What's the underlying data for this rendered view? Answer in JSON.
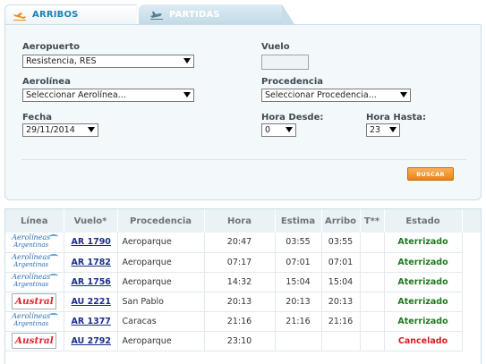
{
  "tabs": {
    "arribos": "ARRIBOS",
    "partidas": "PARTIDAS"
  },
  "form": {
    "aeropuerto_label": "Aeropuerto",
    "aeropuerto_value": "Resistencia, RES",
    "vuelo_label": "Vuelo",
    "vuelo_value": "",
    "aerolinea_label": "Aerolínea",
    "aerolinea_value": "Seleccionar Aerolínea...",
    "procedencia_label": "Procedencia",
    "procedencia_value": "Seleccionar Procedencia...",
    "fecha_label": "Fecha",
    "fecha_value": "29/11/2014",
    "hora_desde_label": "Hora Desde:",
    "hora_desde_value": "0",
    "hora_hasta_label": "Hora Hasta:",
    "hora_hasta_value": "23",
    "buscar_label": "BUSCAR"
  },
  "table": {
    "headers": [
      "Línea",
      "Vuelo*",
      "Procedencia",
      "Hora",
      "Estima",
      "Arribo",
      "T**",
      "Estado"
    ],
    "rows": [
      {
        "airline": "aerolineas",
        "logo_line1": "Aerolíneas",
        "logo_line2": "Argentinas",
        "vuelo": "AR 1790",
        "procedencia": "Aeroparque",
        "hora": "20:47",
        "estima": "03:55",
        "arribo": "03:55",
        "t": "",
        "estado": "Aterrizado"
      },
      {
        "airline": "aerolineas",
        "logo_line1": "Aerolíneas",
        "logo_line2": "Argentinas",
        "vuelo": "AR 1782",
        "procedencia": "Aeroparque",
        "hora": "07:17",
        "estima": "07:01",
        "arribo": "07:01",
        "t": "",
        "estado": "Aterrizado"
      },
      {
        "airline": "aerolineas",
        "logo_line1": "Aerolíneas",
        "logo_line2": "Argentinas",
        "vuelo": "AR 1756",
        "procedencia": "Aeroparque",
        "hora": "14:32",
        "estima": "15:04",
        "arribo": "15:04",
        "t": "",
        "estado": "Aterrizado"
      },
      {
        "airline": "austral",
        "logo_text": "Austral",
        "vuelo": "AU 2221",
        "procedencia": "San Pablo",
        "hora": "20:13",
        "estima": "20:13",
        "arribo": "20:13",
        "t": "",
        "estado": "Aterrizado"
      },
      {
        "airline": "aerolineas",
        "logo_line1": "Aerolíneas",
        "logo_line2": "Argentinas",
        "vuelo": "AR 1377",
        "procedencia": "Caracas",
        "hora": "21:16",
        "estima": "21:16",
        "arribo": "21:16",
        "t": "",
        "estado": "Aterrizado"
      },
      {
        "airline": "austral",
        "logo_text": "Austral",
        "vuelo": "AU 2792",
        "procedencia": "Aeroparque",
        "hora": "23:10",
        "estima": "",
        "arribo": "",
        "t": "",
        "estado": "Cancelado"
      }
    ]
  },
  "colors": {
    "accent": "#1d7fb5",
    "landed": "#1f7a1f",
    "cancelled": "#d42020",
    "button": "#e98414"
  }
}
